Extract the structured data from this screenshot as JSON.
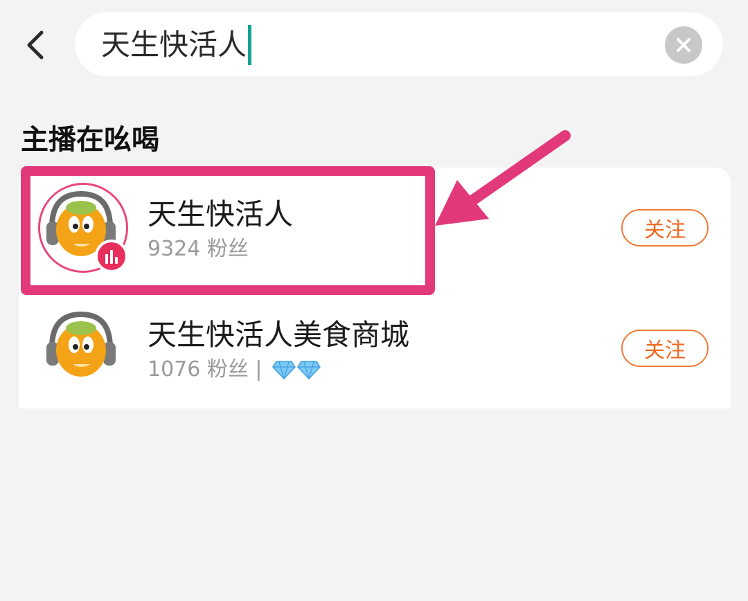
{
  "search": {
    "query": "天生快活人"
  },
  "section": {
    "title": "主播在吆喝"
  },
  "results": [
    {
      "name": "天生快活人",
      "fans_text": "9324 粉丝",
      "follow_label": "关注",
      "live": true
    },
    {
      "name": "天生快活人美食商城",
      "fans_text": "1076 粉丝 |",
      "follow_label": "关注",
      "diamonds": 2
    }
  ],
  "colors": {
    "accent": "#ee6a22",
    "highlight": "#e2397a",
    "caret": "#13a392",
    "live_badge": "#ea2e5d"
  },
  "icons": {
    "back": "chevron-left-icon",
    "clear": "close-icon",
    "live": "live-bars-icon",
    "diamond": "diamond-icon"
  }
}
